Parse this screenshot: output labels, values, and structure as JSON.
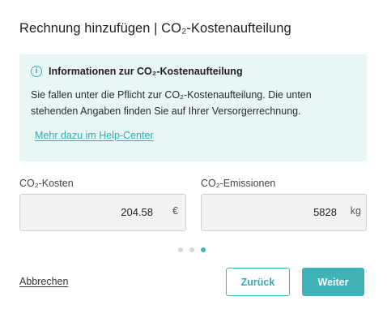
{
  "dialog": {
    "title": "Rechnung hinzufügen | CO₂-Kostenaufteilung"
  },
  "info": {
    "icon": "info-icon",
    "title": "Informationen zur CO₂-Kostenaufteilung",
    "text": "Sie fallen unter die Pflicht zur CO₂-Kostenaufteilung. Die unten stehenden Angaben finden Sie auf Ihrer Versorgerrechnung.",
    "link": "Mehr dazu im Help-Center"
  },
  "fields": {
    "costs": {
      "label": "CO₂-Kosten",
      "value": "204.58",
      "unit": "€"
    },
    "emissions": {
      "label": "CO₂-Emissionen",
      "value": "5828",
      "unit": "kg"
    }
  },
  "steps": {
    "total": 3,
    "current": 3
  },
  "footer": {
    "cancel_label": "Abbrechen",
    "back_label": "Zurück",
    "next_label": "Weiter"
  },
  "colors": {
    "accent": "#3fb2b7",
    "info_bg": "#e9f6f6"
  }
}
